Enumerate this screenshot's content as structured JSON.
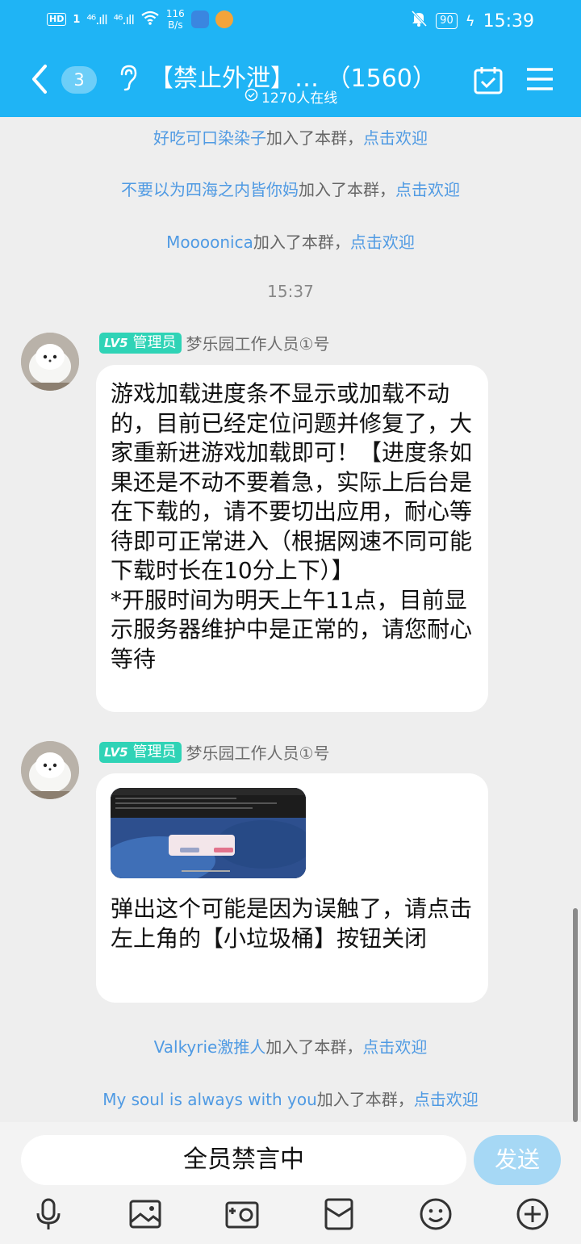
{
  "status_bar": {
    "hd": "HD",
    "sim": "1",
    "sig1": "⁴⁶.ıll",
    "sig2": "⁴⁶.ıll",
    "speed_value": "116",
    "speed_unit": "B/s",
    "battery": "90",
    "time": "15:39"
  },
  "nav": {
    "unread_count": "3",
    "title": "【禁止外泄】… （1560）",
    "online": "1270人在线"
  },
  "join_notices_top": [
    {
      "name": "好吃可口染染子",
      "text": "加入了本群，",
      "action": "点击欢迎"
    },
    {
      "name": "不要以为四海之内皆你妈",
      "text": "加入了本群，",
      "action": "点击欢迎"
    },
    {
      "name": "Moooonica",
      "text": "加入了本群，",
      "action": "点击欢迎"
    }
  ],
  "timestamp": "15:37",
  "messages": [
    {
      "level": "LV5",
      "role": "管理员",
      "sender": "梦乐园工作人员①号",
      "text": "游戏加载进度条不显示或加载不动的，目前已经定位问题并修复了，大家重新进游戏加载即可！【进度条如果还是不动不要着急，实际上后台是在下载的，请不要切出应用，耐心等待即可正常进入（根据网速不同可能下载时长在10分上下）】\n*开服时间为明天上午11点，目前显示服务器维护中是正常的，请您耐心等待"
    },
    {
      "level": "LV5",
      "role": "管理员",
      "sender": "梦乐园工作人员①号",
      "text": "弹出这个可能是因为误触了，请点击左上角的【小垃圾桶】按钮关闭"
    }
  ],
  "join_notices_bottom": [
    {
      "name": "Valkyrie激推人",
      "text": "加入了本群，",
      "action": "点击欢迎"
    },
    {
      "name": "My soul is always with you",
      "text": "加入了本群，",
      "action": "点击欢迎"
    }
  ],
  "input": {
    "mute_text": "全员禁言中",
    "send_label": "发送"
  },
  "toolbar_icons": [
    "microphone-icon",
    "image-icon",
    "camera-icon",
    "red-packet-icon",
    "emoji-icon",
    "plus-icon"
  ],
  "colors": {
    "header": "#1fb4f5",
    "link": "#4f9ae3",
    "admin_badge": "#2fd3b6",
    "send_button": "#a6d8f5",
    "background": "#eeeeee"
  }
}
